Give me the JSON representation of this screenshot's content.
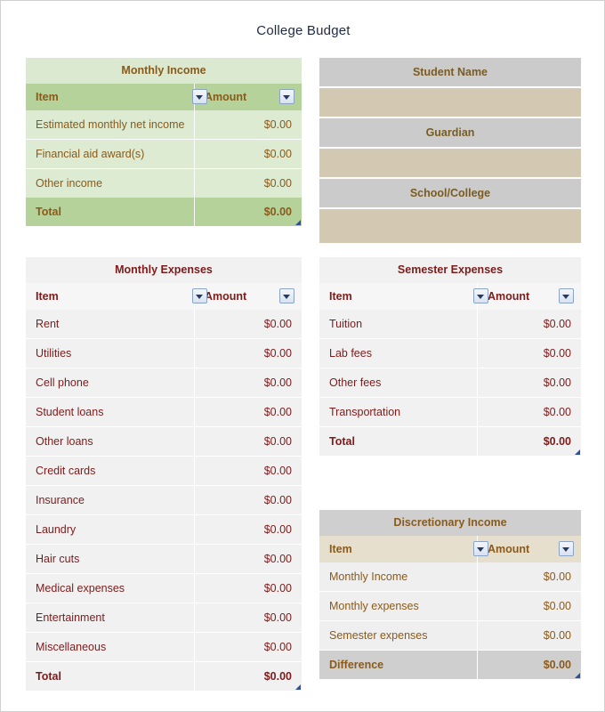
{
  "document": {
    "title": "College Budget"
  },
  "icons": {
    "filter_dropdown": "chevron-down-icon",
    "resize_grip": "resize-grip-icon"
  },
  "colors": {
    "income_title_bg": "#dbe9d0",
    "income_header_bg": "#b4d29a",
    "income_body_bg": "#dcebd2",
    "income_text": "#8a5a1a",
    "expense_bg": "#f1f1f1",
    "expense_text": "#7d1b1b",
    "discretionary_title_bg": "#cfcfcf",
    "discretionary_header_bg": "#e7dfcd",
    "info_label_bg": "#cbcbcb",
    "info_field_bg": "#d3c9b3",
    "page_title_text": "#1f2a44",
    "filter_arrow": "#243b67"
  },
  "monthly_income": {
    "caption": "Monthly Income",
    "columns": [
      "Item",
      "Amount"
    ],
    "rows": [
      {
        "item": "Estimated monthly net income",
        "amount": "$0.00"
      },
      {
        "item": "Financial aid award(s)",
        "amount": "$0.00"
      },
      {
        "item": "Other income",
        "amount": "$0.00"
      }
    ],
    "total": {
      "label": "Total",
      "amount": "$0.00"
    }
  },
  "student_info": {
    "fields": [
      {
        "label": "Student Name",
        "value": ""
      },
      {
        "label": "Guardian",
        "value": ""
      },
      {
        "label": "School/College",
        "value": ""
      }
    ]
  },
  "monthly_expenses": {
    "caption": "Monthly Expenses",
    "columns": [
      "Item",
      "Amount"
    ],
    "rows": [
      {
        "item": "Rent",
        "amount": "$0.00"
      },
      {
        "item": "Utilities",
        "amount": "$0.00"
      },
      {
        "item": "Cell phone",
        "amount": "$0.00"
      },
      {
        "item": "Student loans",
        "amount": "$0.00"
      },
      {
        "item": "Other loans",
        "amount": "$0.00"
      },
      {
        "item": "Credit cards",
        "amount": "$0.00"
      },
      {
        "item": "Insurance",
        "amount": "$0.00"
      },
      {
        "item": "Laundry",
        "amount": "$0.00"
      },
      {
        "item": "Hair cuts",
        "amount": "$0.00"
      },
      {
        "item": "Medical expenses",
        "amount": "$0.00"
      },
      {
        "item": "Entertainment",
        "amount": "$0.00"
      },
      {
        "item": "Miscellaneous",
        "amount": "$0.00"
      }
    ],
    "total": {
      "label": "Total",
      "amount": "$0.00"
    }
  },
  "semester_expenses": {
    "caption": "Semester Expenses",
    "columns": [
      "Item",
      "Amount"
    ],
    "rows": [
      {
        "item": "Tuition",
        "amount": "$0.00"
      },
      {
        "item": "Lab fees",
        "amount": "$0.00"
      },
      {
        "item": "Other fees",
        "amount": "$0.00"
      },
      {
        "item": "Transportation",
        "amount": "$0.00"
      }
    ],
    "total": {
      "label": "Total",
      "amount": "$0.00"
    }
  },
  "discretionary_income": {
    "caption": "Discretionary Income",
    "columns": [
      "Item",
      "Amount"
    ],
    "rows": [
      {
        "item": "Monthly Income",
        "amount": "$0.00"
      },
      {
        "item": "Monthly expenses",
        "amount": "$0.00"
      },
      {
        "item": "Semester expenses",
        "amount": "$0.00"
      }
    ],
    "total": {
      "label": "Difference",
      "amount": "$0.00"
    }
  }
}
